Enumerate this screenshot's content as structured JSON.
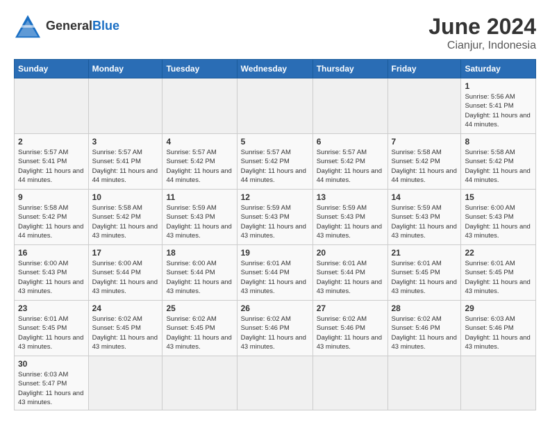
{
  "header": {
    "logo_general": "General",
    "logo_blue": "Blue",
    "month_title": "June 2024",
    "subtitle": "Cianjur, Indonesia"
  },
  "days_of_week": [
    "Sunday",
    "Monday",
    "Tuesday",
    "Wednesday",
    "Thursday",
    "Friday",
    "Saturday"
  ],
  "weeks": [
    [
      {
        "day": "",
        "empty": true
      },
      {
        "day": "",
        "empty": true
      },
      {
        "day": "",
        "empty": true
      },
      {
        "day": "",
        "empty": true
      },
      {
        "day": "",
        "empty": true
      },
      {
        "day": "",
        "empty": true
      },
      {
        "day": "1",
        "sunrise": "5:56 AM",
        "sunset": "5:41 PM",
        "daylight": "11 hours and 44 minutes."
      }
    ],
    [
      {
        "day": "2",
        "sunrise": "5:57 AM",
        "sunset": "5:41 PM",
        "daylight": "11 hours and 44 minutes."
      },
      {
        "day": "3",
        "sunrise": "5:57 AM",
        "sunset": "5:41 PM",
        "daylight": "11 hours and 44 minutes."
      },
      {
        "day": "4",
        "sunrise": "5:57 AM",
        "sunset": "5:42 PM",
        "daylight": "11 hours and 44 minutes."
      },
      {
        "day": "5",
        "sunrise": "5:57 AM",
        "sunset": "5:42 PM",
        "daylight": "11 hours and 44 minutes."
      },
      {
        "day": "6",
        "sunrise": "5:57 AM",
        "sunset": "5:42 PM",
        "daylight": "11 hours and 44 minutes."
      },
      {
        "day": "7",
        "sunrise": "5:58 AM",
        "sunset": "5:42 PM",
        "daylight": "11 hours and 44 minutes."
      },
      {
        "day": "8",
        "sunrise": "5:58 AM",
        "sunset": "5:42 PM",
        "daylight": "11 hours and 44 minutes."
      }
    ],
    [
      {
        "day": "9",
        "sunrise": "5:58 AM",
        "sunset": "5:42 PM",
        "daylight": "11 hours and 44 minutes."
      },
      {
        "day": "10",
        "sunrise": "5:58 AM",
        "sunset": "5:42 PM",
        "daylight": "11 hours and 43 minutes."
      },
      {
        "day": "11",
        "sunrise": "5:59 AM",
        "sunset": "5:43 PM",
        "daylight": "11 hours and 43 minutes."
      },
      {
        "day": "12",
        "sunrise": "5:59 AM",
        "sunset": "5:43 PM",
        "daylight": "11 hours and 43 minutes."
      },
      {
        "day": "13",
        "sunrise": "5:59 AM",
        "sunset": "5:43 PM",
        "daylight": "11 hours and 43 minutes."
      },
      {
        "day": "14",
        "sunrise": "5:59 AM",
        "sunset": "5:43 PM",
        "daylight": "11 hours and 43 minutes."
      },
      {
        "day": "15",
        "sunrise": "6:00 AM",
        "sunset": "5:43 PM",
        "daylight": "11 hours and 43 minutes."
      }
    ],
    [
      {
        "day": "16",
        "sunrise": "6:00 AM",
        "sunset": "5:43 PM",
        "daylight": "11 hours and 43 minutes."
      },
      {
        "day": "17",
        "sunrise": "6:00 AM",
        "sunset": "5:44 PM",
        "daylight": "11 hours and 43 minutes."
      },
      {
        "day": "18",
        "sunrise": "6:00 AM",
        "sunset": "5:44 PM",
        "daylight": "11 hours and 43 minutes."
      },
      {
        "day": "19",
        "sunrise": "6:01 AM",
        "sunset": "5:44 PM",
        "daylight": "11 hours and 43 minutes."
      },
      {
        "day": "20",
        "sunrise": "6:01 AM",
        "sunset": "5:44 PM",
        "daylight": "11 hours and 43 minutes."
      },
      {
        "day": "21",
        "sunrise": "6:01 AM",
        "sunset": "5:45 PM",
        "daylight": "11 hours and 43 minutes."
      },
      {
        "day": "22",
        "sunrise": "6:01 AM",
        "sunset": "5:45 PM",
        "daylight": "11 hours and 43 minutes."
      }
    ],
    [
      {
        "day": "23",
        "sunrise": "6:01 AM",
        "sunset": "5:45 PM",
        "daylight": "11 hours and 43 minutes."
      },
      {
        "day": "24",
        "sunrise": "6:02 AM",
        "sunset": "5:45 PM",
        "daylight": "11 hours and 43 minutes."
      },
      {
        "day": "25",
        "sunrise": "6:02 AM",
        "sunset": "5:45 PM",
        "daylight": "11 hours and 43 minutes."
      },
      {
        "day": "26",
        "sunrise": "6:02 AM",
        "sunset": "5:46 PM",
        "daylight": "11 hours and 43 minutes."
      },
      {
        "day": "27",
        "sunrise": "6:02 AM",
        "sunset": "5:46 PM",
        "daylight": "11 hours and 43 minutes."
      },
      {
        "day": "28",
        "sunrise": "6:02 AM",
        "sunset": "5:46 PM",
        "daylight": "11 hours and 43 minutes."
      },
      {
        "day": "29",
        "sunrise": "6:03 AM",
        "sunset": "5:46 PM",
        "daylight": "11 hours and 43 minutes."
      }
    ],
    [
      {
        "day": "30",
        "sunrise": "6:03 AM",
        "sunset": "5:47 PM",
        "daylight": "11 hours and 43 minutes."
      },
      {
        "day": "",
        "empty": true
      },
      {
        "day": "",
        "empty": true
      },
      {
        "day": "",
        "empty": true
      },
      {
        "day": "",
        "empty": true
      },
      {
        "day": "",
        "empty": true
      },
      {
        "day": "",
        "empty": true
      }
    ]
  ]
}
